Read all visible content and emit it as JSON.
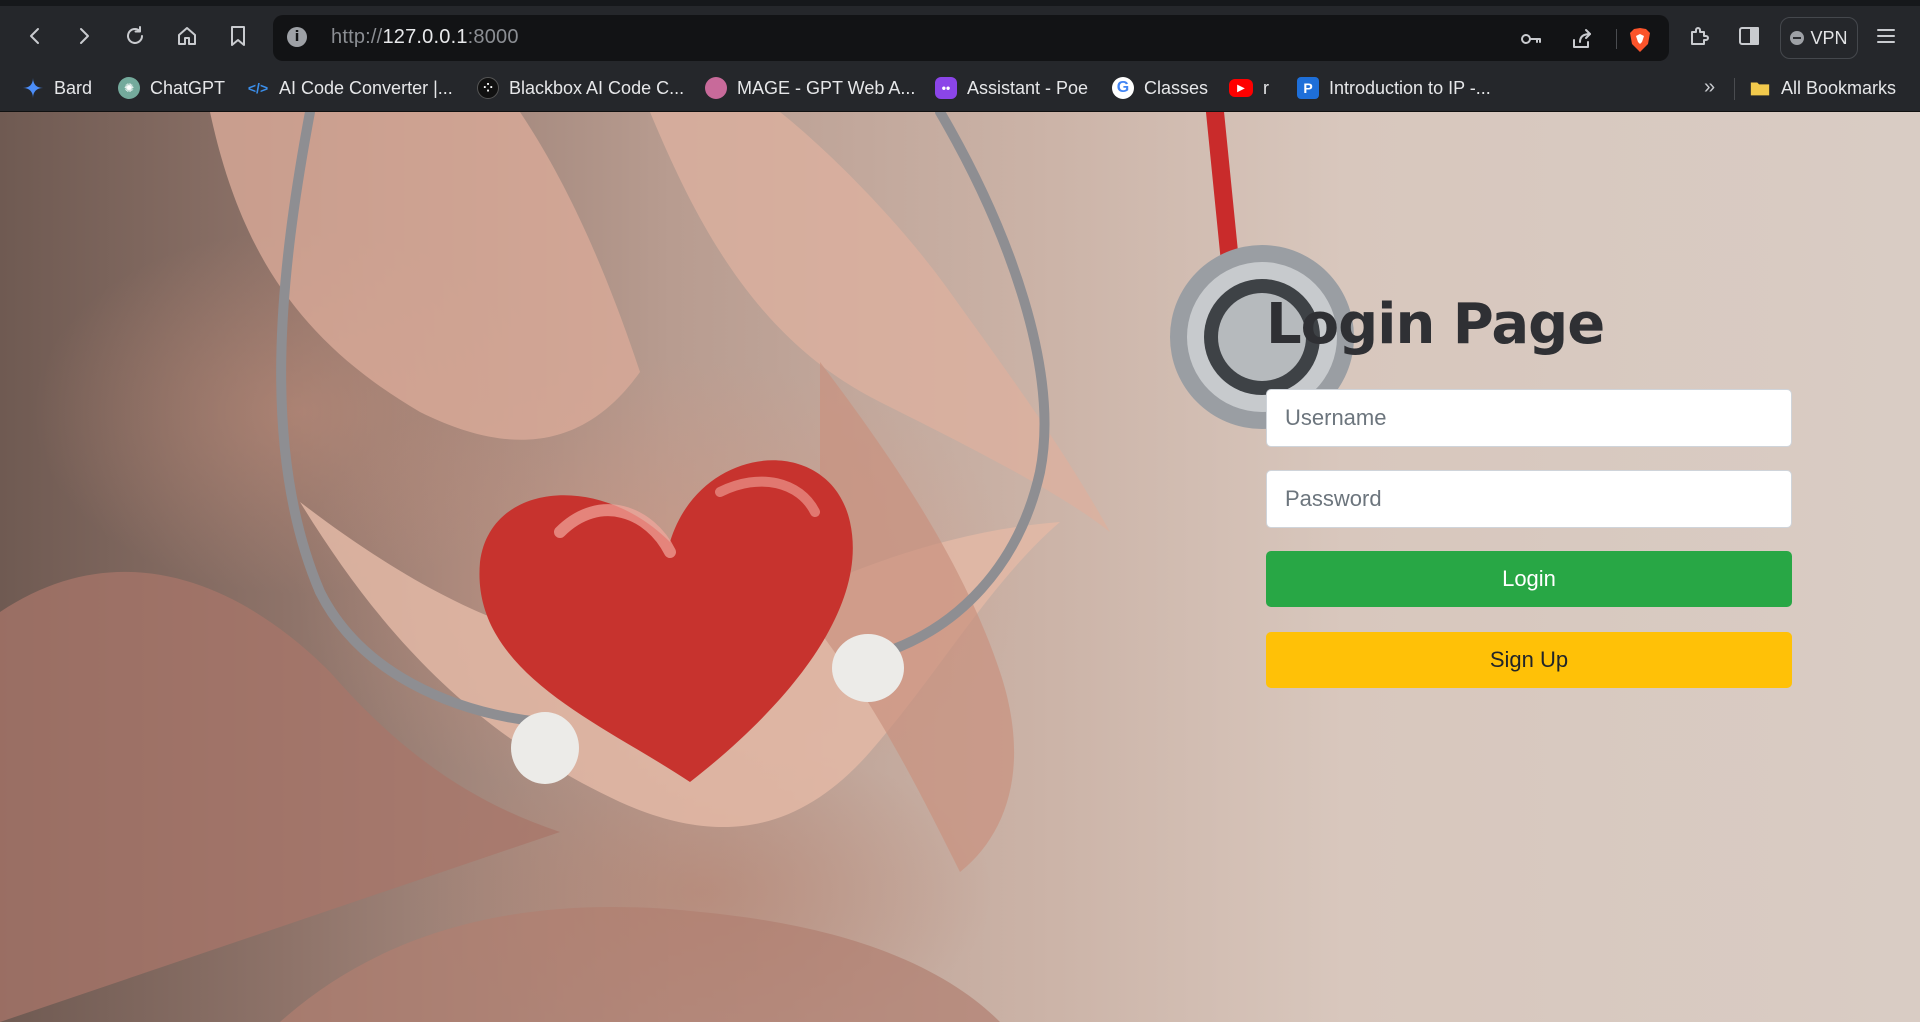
{
  "browser": {
    "url_prefix": "http://",
    "url_host": "127.0.0.1",
    "url_port": ":8000",
    "vpn_label": "VPN"
  },
  "bookmarks": [
    {
      "label": "Bard",
      "icon": "bard-icon",
      "color": "#4b8df8"
    },
    {
      "label": "ChatGPT",
      "icon": "chatgpt-icon",
      "color": "#74aa9c"
    },
    {
      "label": "AI Code Converter |...",
      "icon": "code-icon",
      "color": "#3b8eea"
    },
    {
      "label": "Blackbox AI Code C...",
      "icon": "blackbox-icon",
      "color": "#111111"
    },
    {
      "label": "MAGE - GPT Web A...",
      "icon": "mage-icon",
      "color": "#c86a9a"
    },
    {
      "label": "Assistant - Poe",
      "icon": "poe-icon",
      "color": "#8b45e8"
    },
    {
      "label": "Classes",
      "icon": "google-icon",
      "color": "#ffffff"
    },
    {
      "label": "r",
      "icon": "youtube-icon",
      "color": "#ff0000"
    },
    {
      "label": "Introduction to IP -...",
      "icon": "pearson-icon",
      "color": "#1e6fd9"
    }
  ],
  "all_bookmarks_label": "All Bookmarks",
  "overflow_label": "»",
  "login": {
    "title": "Login Page",
    "username_placeholder": "Username",
    "password_placeholder": "Password",
    "login_label": "Login",
    "signup_label": "Sign Up"
  },
  "colors": {
    "login_button": "#28a745",
    "signup_button": "#ffc107"
  }
}
